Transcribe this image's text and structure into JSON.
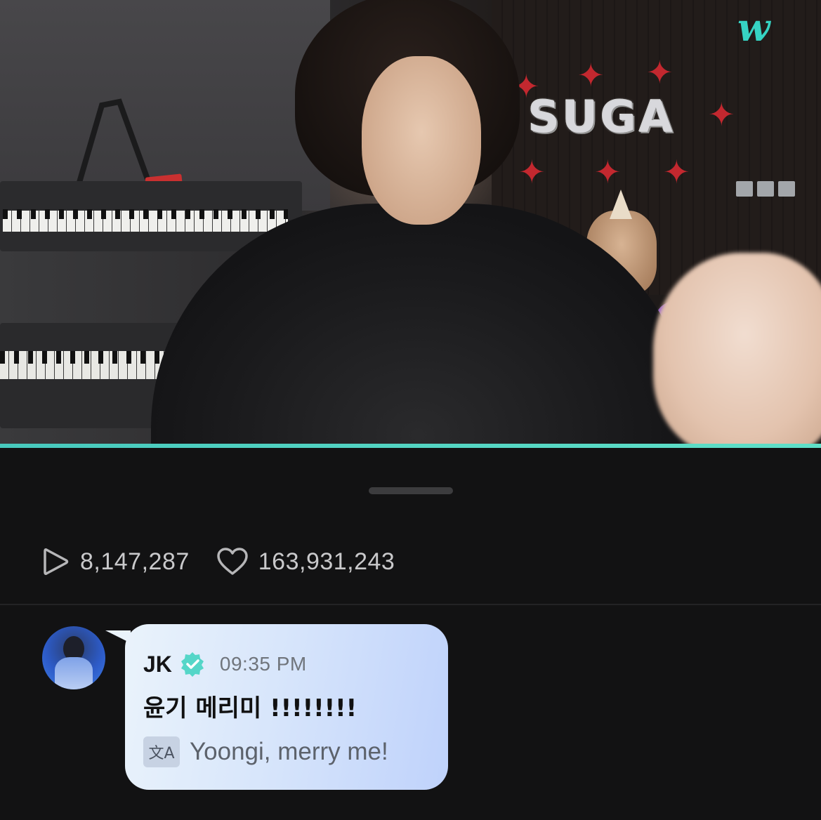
{
  "app": {
    "logo_text": "w",
    "accent_color": "#36d3c3"
  },
  "video": {
    "balloon_text": "SUGA",
    "progress_color": "#47c9bd"
  },
  "stats": {
    "plays": {
      "icon": "play-icon",
      "value": "8,147,287"
    },
    "likes": {
      "icon": "heart-icon",
      "value": "163,931,243"
    }
  },
  "comment": {
    "author": "JK",
    "verified_icon": "verified-badge-icon",
    "time": "09:35 PM",
    "message": "윤기 메리미 !!!!!!!!",
    "translate_icon_glyph": "文A",
    "translation": "Yoongi, merry me!"
  }
}
